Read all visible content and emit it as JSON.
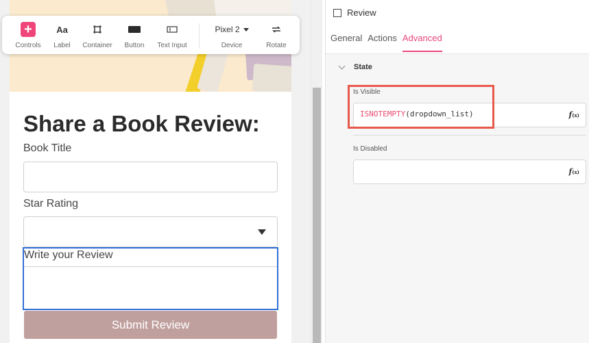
{
  "toolbar": {
    "items": [
      {
        "label": "Controls",
        "icon": "plus-icon"
      },
      {
        "label": "Label",
        "icon": "text-icon",
        "glyph": "Aa"
      },
      {
        "label": "Container",
        "icon": "container-icon"
      },
      {
        "label": "Button",
        "icon": "button-icon"
      },
      {
        "label": "Text Input",
        "icon": "text-input-icon"
      },
      {
        "label": "Device",
        "value": "Pixel 2",
        "icon": "caret-down-icon"
      },
      {
        "label": "Rotate",
        "icon": "rotate-icon"
      }
    ]
  },
  "form": {
    "title": "Share a Book Review:",
    "book_title_label": "Book Title",
    "star_rating_label": "Star Rating",
    "review_label": "Write your Review",
    "submit_label": "Submit Review"
  },
  "panel": {
    "title": "Review",
    "tabs": [
      "General",
      "Actions",
      "Advanced"
    ],
    "active_tab": "Advanced",
    "section": "State",
    "visible_label": "Is Visible",
    "visible_fn": "ISNOTEMPTY",
    "visible_args": "(dropdown_list)",
    "disabled_label": "Is Disabled",
    "disabled_value": "",
    "fx_label": "f",
    "fx_sub": "(x)"
  },
  "colors": {
    "accent": "#e8467c",
    "highlight": "#e8584a",
    "selection": "#2f6fd6",
    "submit_bg": "#c0a09e"
  }
}
